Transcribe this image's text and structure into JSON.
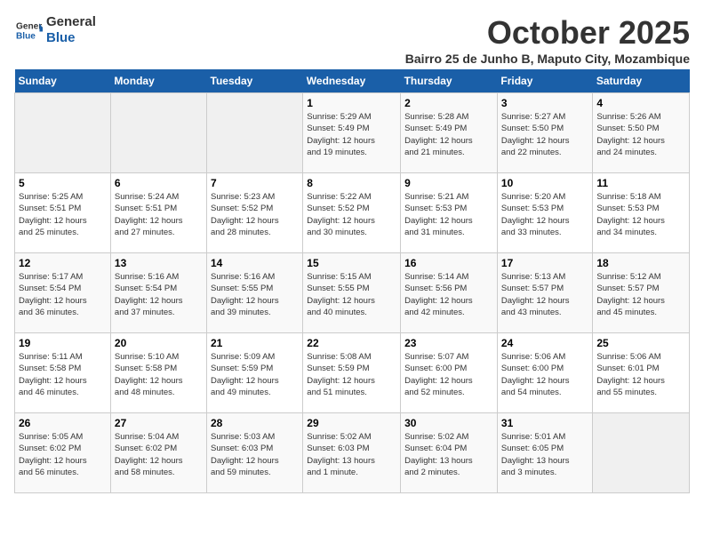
{
  "logo": {
    "line1": "General",
    "line2": "Blue"
  },
  "title": "October 2025",
  "subtitle": "Bairro 25 de Junho B, Maputo City, Mozambique",
  "days_of_week": [
    "Sunday",
    "Monday",
    "Tuesday",
    "Wednesday",
    "Thursday",
    "Friday",
    "Saturday"
  ],
  "weeks": [
    [
      {
        "day": "",
        "info": ""
      },
      {
        "day": "",
        "info": ""
      },
      {
        "day": "",
        "info": ""
      },
      {
        "day": "1",
        "info": "Sunrise: 5:29 AM\nSunset: 5:49 PM\nDaylight: 12 hours\nand 19 minutes."
      },
      {
        "day": "2",
        "info": "Sunrise: 5:28 AM\nSunset: 5:49 PM\nDaylight: 12 hours\nand 21 minutes."
      },
      {
        "day": "3",
        "info": "Sunrise: 5:27 AM\nSunset: 5:50 PM\nDaylight: 12 hours\nand 22 minutes."
      },
      {
        "day": "4",
        "info": "Sunrise: 5:26 AM\nSunset: 5:50 PM\nDaylight: 12 hours\nand 24 minutes."
      }
    ],
    [
      {
        "day": "5",
        "info": "Sunrise: 5:25 AM\nSunset: 5:51 PM\nDaylight: 12 hours\nand 25 minutes."
      },
      {
        "day": "6",
        "info": "Sunrise: 5:24 AM\nSunset: 5:51 PM\nDaylight: 12 hours\nand 27 minutes."
      },
      {
        "day": "7",
        "info": "Sunrise: 5:23 AM\nSunset: 5:52 PM\nDaylight: 12 hours\nand 28 minutes."
      },
      {
        "day": "8",
        "info": "Sunrise: 5:22 AM\nSunset: 5:52 PM\nDaylight: 12 hours\nand 30 minutes."
      },
      {
        "day": "9",
        "info": "Sunrise: 5:21 AM\nSunset: 5:53 PM\nDaylight: 12 hours\nand 31 minutes."
      },
      {
        "day": "10",
        "info": "Sunrise: 5:20 AM\nSunset: 5:53 PM\nDaylight: 12 hours\nand 33 minutes."
      },
      {
        "day": "11",
        "info": "Sunrise: 5:18 AM\nSunset: 5:53 PM\nDaylight: 12 hours\nand 34 minutes."
      }
    ],
    [
      {
        "day": "12",
        "info": "Sunrise: 5:17 AM\nSunset: 5:54 PM\nDaylight: 12 hours\nand 36 minutes."
      },
      {
        "day": "13",
        "info": "Sunrise: 5:16 AM\nSunset: 5:54 PM\nDaylight: 12 hours\nand 37 minutes."
      },
      {
        "day": "14",
        "info": "Sunrise: 5:16 AM\nSunset: 5:55 PM\nDaylight: 12 hours\nand 39 minutes."
      },
      {
        "day": "15",
        "info": "Sunrise: 5:15 AM\nSunset: 5:55 PM\nDaylight: 12 hours\nand 40 minutes."
      },
      {
        "day": "16",
        "info": "Sunrise: 5:14 AM\nSunset: 5:56 PM\nDaylight: 12 hours\nand 42 minutes."
      },
      {
        "day": "17",
        "info": "Sunrise: 5:13 AM\nSunset: 5:57 PM\nDaylight: 12 hours\nand 43 minutes."
      },
      {
        "day": "18",
        "info": "Sunrise: 5:12 AM\nSunset: 5:57 PM\nDaylight: 12 hours\nand 45 minutes."
      }
    ],
    [
      {
        "day": "19",
        "info": "Sunrise: 5:11 AM\nSunset: 5:58 PM\nDaylight: 12 hours\nand 46 minutes."
      },
      {
        "day": "20",
        "info": "Sunrise: 5:10 AM\nSunset: 5:58 PM\nDaylight: 12 hours\nand 48 minutes."
      },
      {
        "day": "21",
        "info": "Sunrise: 5:09 AM\nSunset: 5:59 PM\nDaylight: 12 hours\nand 49 minutes."
      },
      {
        "day": "22",
        "info": "Sunrise: 5:08 AM\nSunset: 5:59 PM\nDaylight: 12 hours\nand 51 minutes."
      },
      {
        "day": "23",
        "info": "Sunrise: 5:07 AM\nSunset: 6:00 PM\nDaylight: 12 hours\nand 52 minutes."
      },
      {
        "day": "24",
        "info": "Sunrise: 5:06 AM\nSunset: 6:00 PM\nDaylight: 12 hours\nand 54 minutes."
      },
      {
        "day": "25",
        "info": "Sunrise: 5:06 AM\nSunset: 6:01 PM\nDaylight: 12 hours\nand 55 minutes."
      }
    ],
    [
      {
        "day": "26",
        "info": "Sunrise: 5:05 AM\nSunset: 6:02 PM\nDaylight: 12 hours\nand 56 minutes."
      },
      {
        "day": "27",
        "info": "Sunrise: 5:04 AM\nSunset: 6:02 PM\nDaylight: 12 hours\nand 58 minutes."
      },
      {
        "day": "28",
        "info": "Sunrise: 5:03 AM\nSunset: 6:03 PM\nDaylight: 12 hours\nand 59 minutes."
      },
      {
        "day": "29",
        "info": "Sunrise: 5:02 AM\nSunset: 6:03 PM\nDaylight: 13 hours\nand 1 minute."
      },
      {
        "day": "30",
        "info": "Sunrise: 5:02 AM\nSunset: 6:04 PM\nDaylight: 13 hours\nand 2 minutes."
      },
      {
        "day": "31",
        "info": "Sunrise: 5:01 AM\nSunset: 6:05 PM\nDaylight: 13 hours\nand 3 minutes."
      },
      {
        "day": "",
        "info": ""
      }
    ]
  ]
}
